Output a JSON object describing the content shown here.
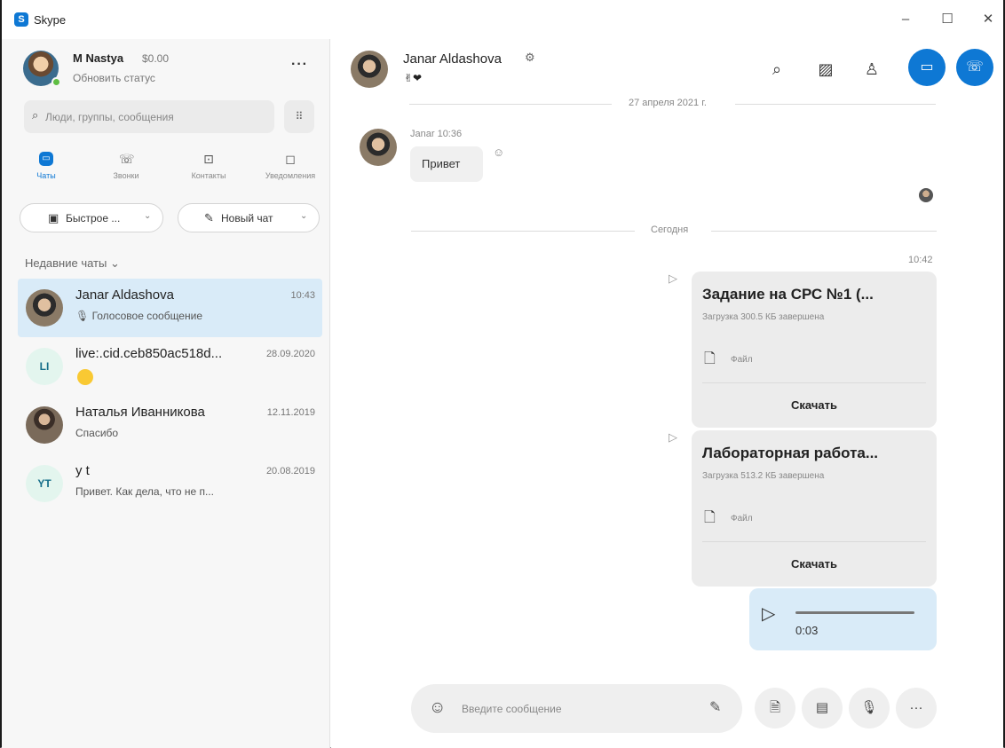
{
  "window": {
    "app_title": "Skype",
    "logo_letter": "S",
    "controls": {
      "minimize": "–",
      "maximize": "☐",
      "close": "✕"
    }
  },
  "profile": {
    "name": "M Nastya",
    "credit": "$0.00",
    "status_text": "Обновить статус",
    "more": "···"
  },
  "search": {
    "placeholder": "Люди, группы, сообщения",
    "dialpad_icon": "dialpad-icon"
  },
  "tabs": [
    {
      "label": "Чаты",
      "icon": "chat-icon",
      "glyph": "▭",
      "active": true
    },
    {
      "label": "Звонки",
      "icon": "phone-icon",
      "glyph": "☏",
      "active": false
    },
    {
      "label": "Контакты",
      "icon": "contacts-icon",
      "glyph": "⊡",
      "active": false
    },
    {
      "label": "Уведомления",
      "icon": "bell-icon",
      "glyph": "◻",
      "active": false
    }
  ],
  "quick_actions": {
    "meet_label": "Быстрое ...",
    "new_chat_label": "Новый чат"
  },
  "recent_label": "Недавние чаты ⌄",
  "chats": [
    {
      "name": "Janar Aldashova",
      "time": "10:43",
      "preview": "🎙 Голосовое сообщение",
      "avatar": "photo"
    },
    {
      "name": "live:.cid.ceb850ac518d...",
      "time": "28.09.2020",
      "preview": "",
      "avatar_initials": "LI"
    },
    {
      "name": "Наталья Иванникова",
      "time": "12.11.2019",
      "preview": "Спасибо",
      "avatar": "photo"
    },
    {
      "name": "y t",
      "time": "20.08.2019",
      "preview": "Привет. Как дела, что не п...",
      "avatar_initials": "YT"
    }
  ],
  "conversation": {
    "contact_name": "Janar Aldashova",
    "mood": "✌❤",
    "header_icons": [
      "search-icon",
      "gallery-icon",
      "add-person-icon",
      "video-call-icon",
      "audio-call-icon"
    ],
    "date_divider_1": "27 апреля 2021 г.",
    "message_meta": "Janar 10:36",
    "message_text": "Привет",
    "date_divider_2": "Сегодня",
    "sent_time": "10:42",
    "files": [
      {
        "title": "Задание на СРС №1 (...",
        "status": "Загрузка 300.5 КБ завершена",
        "file_label": "Файл",
        "download": "Скачать"
      },
      {
        "title": "Лабораторная работа...",
        "status": "Загрузка 513.2 КБ завершена",
        "file_label": "Файл",
        "download": "Скачать"
      }
    ],
    "voice": {
      "duration": "0:03",
      "progress": 0
    }
  },
  "composer": {
    "placeholder": "Введите сообщение",
    "more": "···"
  },
  "colors": {
    "accent": "#0e78d4",
    "selected_row": "#d9ebf8",
    "online": "#5fbe43"
  }
}
